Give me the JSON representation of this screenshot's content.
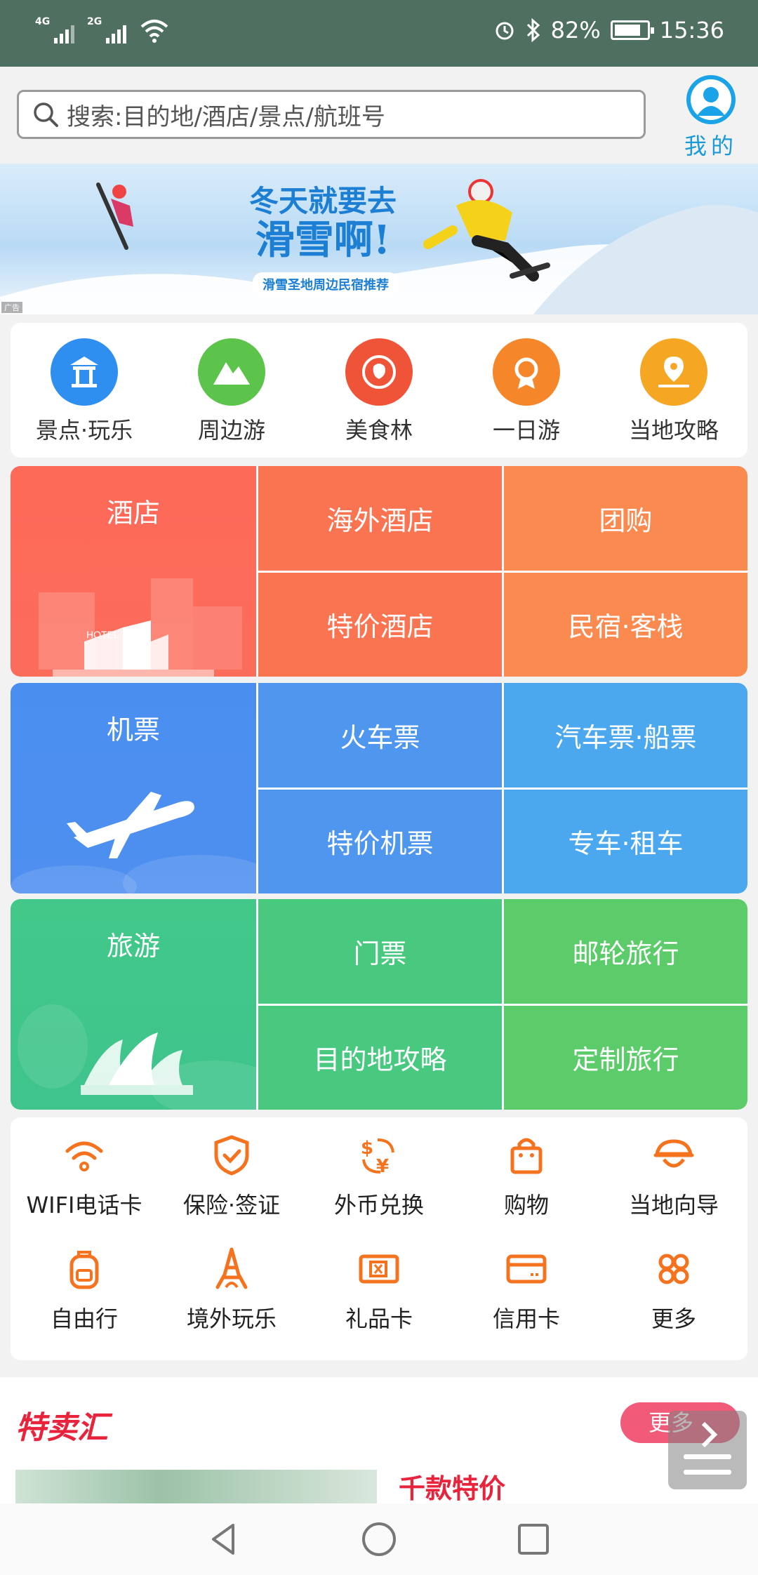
{
  "status_bar": {
    "network1": "4G",
    "network2": "2G",
    "battery": "82%",
    "time": "15:36"
  },
  "header": {
    "search_placeholder": "搜索:目的地/酒店/景点/航班号",
    "me_label": "我的"
  },
  "banner": {
    "line1": "冬天就要去",
    "line2": "滑雪啊!",
    "subtitle": "滑雪圣地周边民宿推荐",
    "ad_tag": "广告"
  },
  "quick_nav": [
    {
      "label": "景点·玩乐",
      "icon": "pavilion-icon",
      "color": "#2f8ff0"
    },
    {
      "label": "周边游",
      "icon": "mountain-icon",
      "color": "#5cc44a"
    },
    {
      "label": "美食林",
      "icon": "food-badge-icon",
      "color": "#f05438"
    },
    {
      "label": "一日游",
      "icon": "sun-badge-icon",
      "color": "#f5862a"
    },
    {
      "label": "当地攻略",
      "icon": "map-pin-icon",
      "color": "#f5a623"
    }
  ],
  "hotel_grid": {
    "main": "酒店",
    "hotel_sign": "HOTEL",
    "cells": [
      "海外酒店",
      "团购",
      "特价酒店",
      "民宿·客栈"
    ]
  },
  "air_grid": {
    "main": "机票",
    "cells": [
      "火车票",
      "汽车票·船票",
      "特价机票",
      "专车·租车"
    ]
  },
  "tour_grid": {
    "main": "旅游",
    "cells": [
      "门票",
      "邮轮旅行",
      "目的地攻略",
      "定制旅行"
    ]
  },
  "services": [
    {
      "label": "WIFI电话卡",
      "icon": "wifi-icon"
    },
    {
      "label": "保险·签证",
      "icon": "shield-icon"
    },
    {
      "label": "外币兑换",
      "icon": "currency-exchange-icon"
    },
    {
      "label": "购物",
      "icon": "shopping-bag-icon"
    },
    {
      "label": "当地向导",
      "icon": "guide-hat-icon"
    },
    {
      "label": "自由行",
      "icon": "backpack-icon"
    },
    {
      "label": "境外玩乐",
      "icon": "eiffel-tower-icon"
    },
    {
      "label": "礼品卡",
      "icon": "gift-card-icon"
    },
    {
      "label": "信用卡",
      "icon": "credit-card-icon"
    },
    {
      "label": "更多",
      "icon": "more-grid-icon"
    }
  ],
  "special": {
    "logo": "特卖汇",
    "more": "更多",
    "item_title": "千款特价"
  },
  "accent_color": "#f5731f"
}
